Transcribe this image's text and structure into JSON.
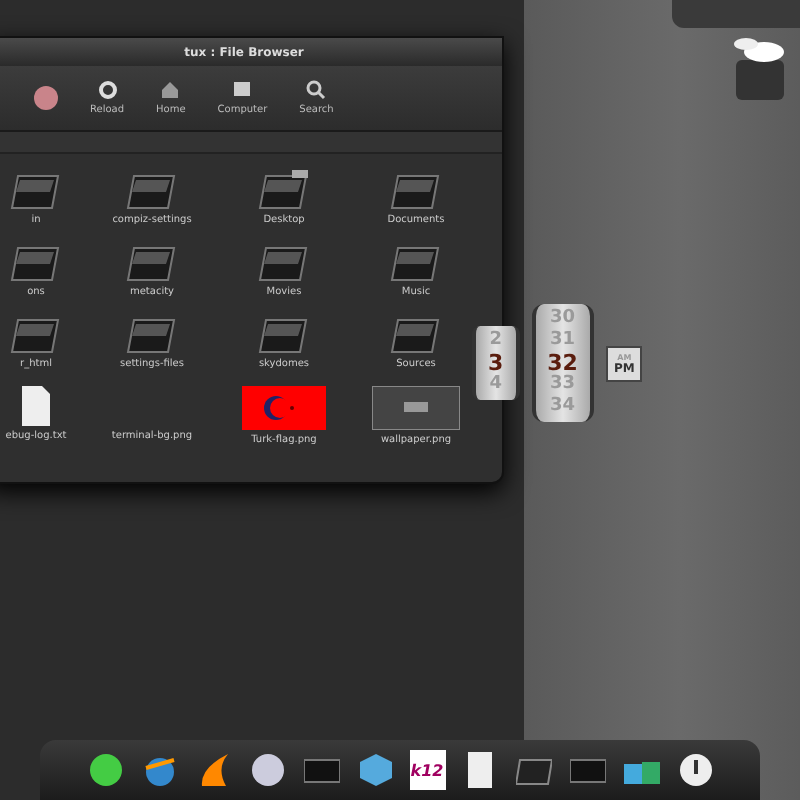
{
  "window": {
    "title": "tux : File Browser"
  },
  "toolbar": [
    {
      "kind": "stop"
    },
    {
      "label": "Reload",
      "kind": "reload"
    },
    {
      "label": "Home",
      "kind": "home"
    },
    {
      "label": "Computer",
      "kind": "computer"
    },
    {
      "label": "Search",
      "kind": "search"
    }
  ],
  "files": [
    {
      "name": "in",
      "kind": "folder"
    },
    {
      "name": "compiz-settings",
      "kind": "folder"
    },
    {
      "name": "Desktop",
      "kind": "desktop"
    },
    {
      "name": "Documents",
      "kind": "folder"
    },
    {
      "name": "ons",
      "kind": "folder"
    },
    {
      "name": "metacity",
      "kind": "folder"
    },
    {
      "name": "Movies",
      "kind": "folder"
    },
    {
      "name": "Music",
      "kind": "folder"
    },
    {
      "name": "r_html",
      "kind": "folder"
    },
    {
      "name": "settings-files",
      "kind": "folder"
    },
    {
      "name": "skydomes",
      "kind": "folder"
    },
    {
      "name": "Sources",
      "kind": "folder"
    },
    {
      "name": "ebug-log.txt",
      "kind": "text"
    },
    {
      "name": "terminal-bg.png",
      "kind": "blank"
    },
    {
      "name": "Turk-flag.png",
      "kind": "flag"
    },
    {
      "name": "wallpaper.png",
      "kind": "wallpaper"
    }
  ],
  "clock": {
    "hours": [
      {
        "label": "2",
        "selected": false
      },
      {
        "label": "3",
        "selected": true
      },
      {
        "label": "4",
        "selected": false
      }
    ],
    "minutes": [
      {
        "label": "30",
        "selected": false
      },
      {
        "label": "31",
        "selected": false
      },
      {
        "label": "32",
        "selected": true
      },
      {
        "label": "33",
        "selected": false
      },
      {
        "label": "34",
        "selected": false
      }
    ],
    "period": [
      {
        "label": "AM",
        "selected": false
      },
      {
        "label": "PM",
        "selected": true
      }
    ]
  },
  "dock": [
    {
      "kind": "green"
    },
    {
      "kind": "globe"
    },
    {
      "kind": "flame"
    },
    {
      "kind": "sphere"
    },
    {
      "kind": "screen"
    },
    {
      "kind": "cube"
    },
    {
      "kind": "k12",
      "label": "k12"
    },
    {
      "kind": "page"
    },
    {
      "kind": "folder"
    },
    {
      "kind": "screen"
    },
    {
      "kind": "windows"
    },
    {
      "kind": "power"
    }
  ]
}
